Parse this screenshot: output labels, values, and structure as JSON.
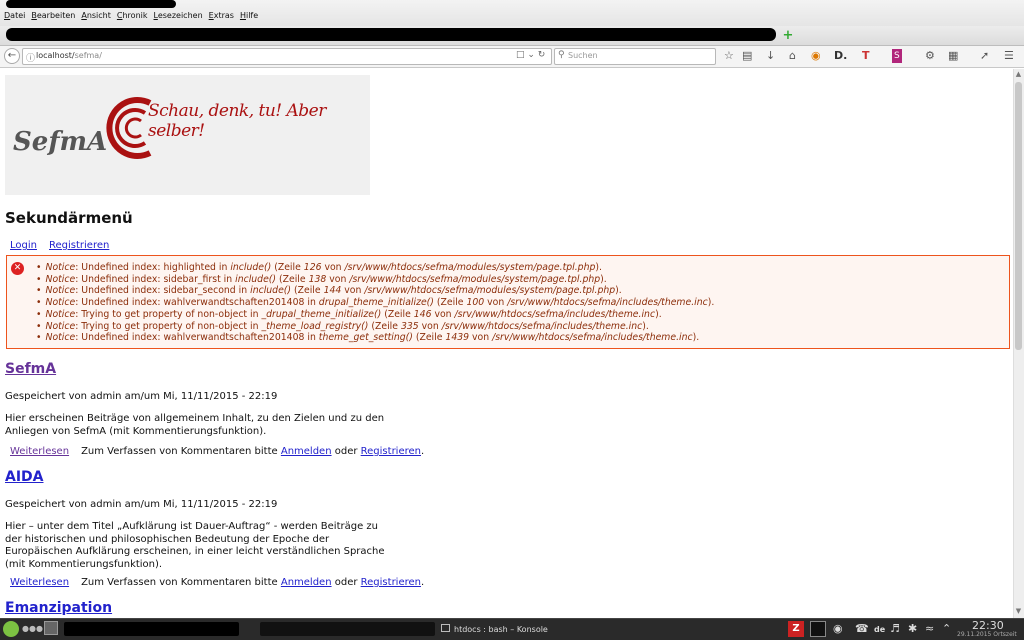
{
  "menu": [
    "Datei",
    "Bearbeiten",
    "Ansicht",
    "Chronik",
    "Lesezeichen",
    "Extras",
    "Hilfe"
  ],
  "nav": {
    "url_host": "localhost/",
    "url_path": "sefma/",
    "search_placeholder": "Suchen"
  },
  "logo": {
    "brand": "SefmA",
    "tagline": "Schau, denk, tu! Aber selber!"
  },
  "sekundaer": {
    "title": "Sekundärmenü",
    "login": "Login",
    "register": "Registrieren"
  },
  "errors": [
    {
      "label": "Notice",
      "msg": ": Undefined index: highlighted in ",
      "fn": "include()",
      "zeile": " (Zeile ",
      "line": "126",
      "von": " von ",
      "file": "/srv/www/htdocs/sefma/modules/system/page.tpl.php",
      "end": ")."
    },
    {
      "label": "Notice",
      "msg": ": Undefined index: sidebar_first in ",
      "fn": "include()",
      "zeile": " (Zeile ",
      "line": "138",
      "von": " von ",
      "file": "/srv/www/htdocs/sefma/modules/system/page.tpl.php",
      "end": ")."
    },
    {
      "label": "Notice",
      "msg": ": Undefined index: sidebar_second in ",
      "fn": "include()",
      "zeile": " (Zeile ",
      "line": "144",
      "von": " von ",
      "file": "/srv/www/htdocs/sefma/modules/system/page.tpl.php",
      "end": ")."
    },
    {
      "label": "Notice",
      "msg": ": Undefined index: wahlverwandtschaften201408 in ",
      "fn": "drupal_theme_initialize()",
      "zeile": " (Zeile ",
      "line": "100",
      "von": " von ",
      "file": "/srv/www/htdocs/sefma/includes/theme.inc",
      "end": ")."
    },
    {
      "label": "Notice",
      "msg": ": Trying to get property of non-object in ",
      "fn": "_drupal_theme_initialize()",
      "zeile": " (Zeile ",
      "line": "146",
      "von": " von ",
      "file": "/srv/www/htdocs/sefma/includes/theme.inc",
      "end": ")."
    },
    {
      "label": "Notice",
      "msg": ": Trying to get property of non-object in ",
      "fn": "_theme_load_registry()",
      "zeile": " (Zeile ",
      "line": "335",
      "von": " von ",
      "file": "/srv/www/htdocs/sefma/includes/theme.inc",
      "end": ")."
    },
    {
      "label": "Notice",
      "msg": ": Undefined index: wahlverwandtschaften201408 in ",
      "fn": "theme_get_setting()",
      "zeile": " (Zeile ",
      "line": "1439",
      "von": " von ",
      "file": "/srv/www/htdocs/sefma/includes/theme.inc",
      "end": ")."
    }
  ],
  "articles": [
    {
      "title": "SefmA",
      "meta": "Gespeichert von admin am/um Mi, 11/11/2015 - 22:19",
      "body": "Hier erscheinen Beiträge von allgemeinem Inhalt, zu den Zielen und zu den Anliegen von SefmA (mit Kommentierungsfunktion).",
      "readmore": "Weiterlesen",
      "c1": "Zum Verfassen von Kommentaren bitte ",
      "login": "Anmelden",
      "c2": " oder ",
      "register": "Registrieren",
      "c3": "."
    },
    {
      "title": "AIDA",
      "meta": "Gespeichert von admin am/um Mi, 11/11/2015 - 22:19",
      "body": "Hier – unter dem Titel „Aufklärung ist Dauer-Auftrag“ - werden Beiträge zu der historischen und philosophischen Bedeutung der Epoche der Europäischen Aufklärung erscheinen, in einer leicht verständlichen Sprache (mit Kommentierungsfunktion).",
      "readmore": "Weiterlesen",
      "c1": "Zum Verfassen von Kommentaren bitte ",
      "login": "Anmelden",
      "c2": " oder ",
      "register": "Registrieren",
      "c3": "."
    },
    {
      "title": "Emanzipation"
    }
  ],
  "taskbar": {
    "konsole": "htdocs : bash – Konsole",
    "lang": "de",
    "time": "22:30",
    "date": "29.11.2015 Ortszeit"
  },
  "colors": {
    "error_border": "#ed541d",
    "error_bg": "#fef5f1",
    "error_text": "#8c2e0b",
    "link": "#2222cc",
    "visited": "#663399",
    "logo_red": "#aa1111"
  }
}
